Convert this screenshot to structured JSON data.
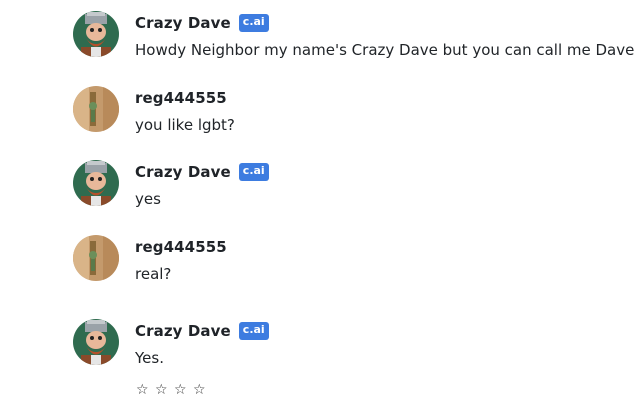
{
  "messages": [
    {
      "author": "Crazy Dave",
      "badge": "c.ai",
      "text": "Howdy Neighbor my name's Crazy Dave but you can call me Dave",
      "avatar_icon": "crazy-dave-avatar"
    },
    {
      "author": "reg444555",
      "badge": "",
      "text": "you like lgbt?",
      "avatar_icon": "user-avatar"
    },
    {
      "author": "Crazy Dave",
      "badge": "c.ai",
      "text": "yes",
      "avatar_icon": "crazy-dave-avatar"
    },
    {
      "author": "reg444555",
      "badge": "",
      "text": "real?",
      "avatar_icon": "user-avatar"
    },
    {
      "author": "Crazy Dave",
      "badge": "c.ai",
      "text": "Yes.",
      "avatar_icon": "crazy-dave-avatar"
    }
  ],
  "rating": {
    "stars": [
      "☆",
      "☆",
      "☆",
      "☆"
    ],
    "value": 0,
    "max": 4
  },
  "colors": {
    "badge_bg": "#3d7ce0",
    "text": "#212529"
  }
}
